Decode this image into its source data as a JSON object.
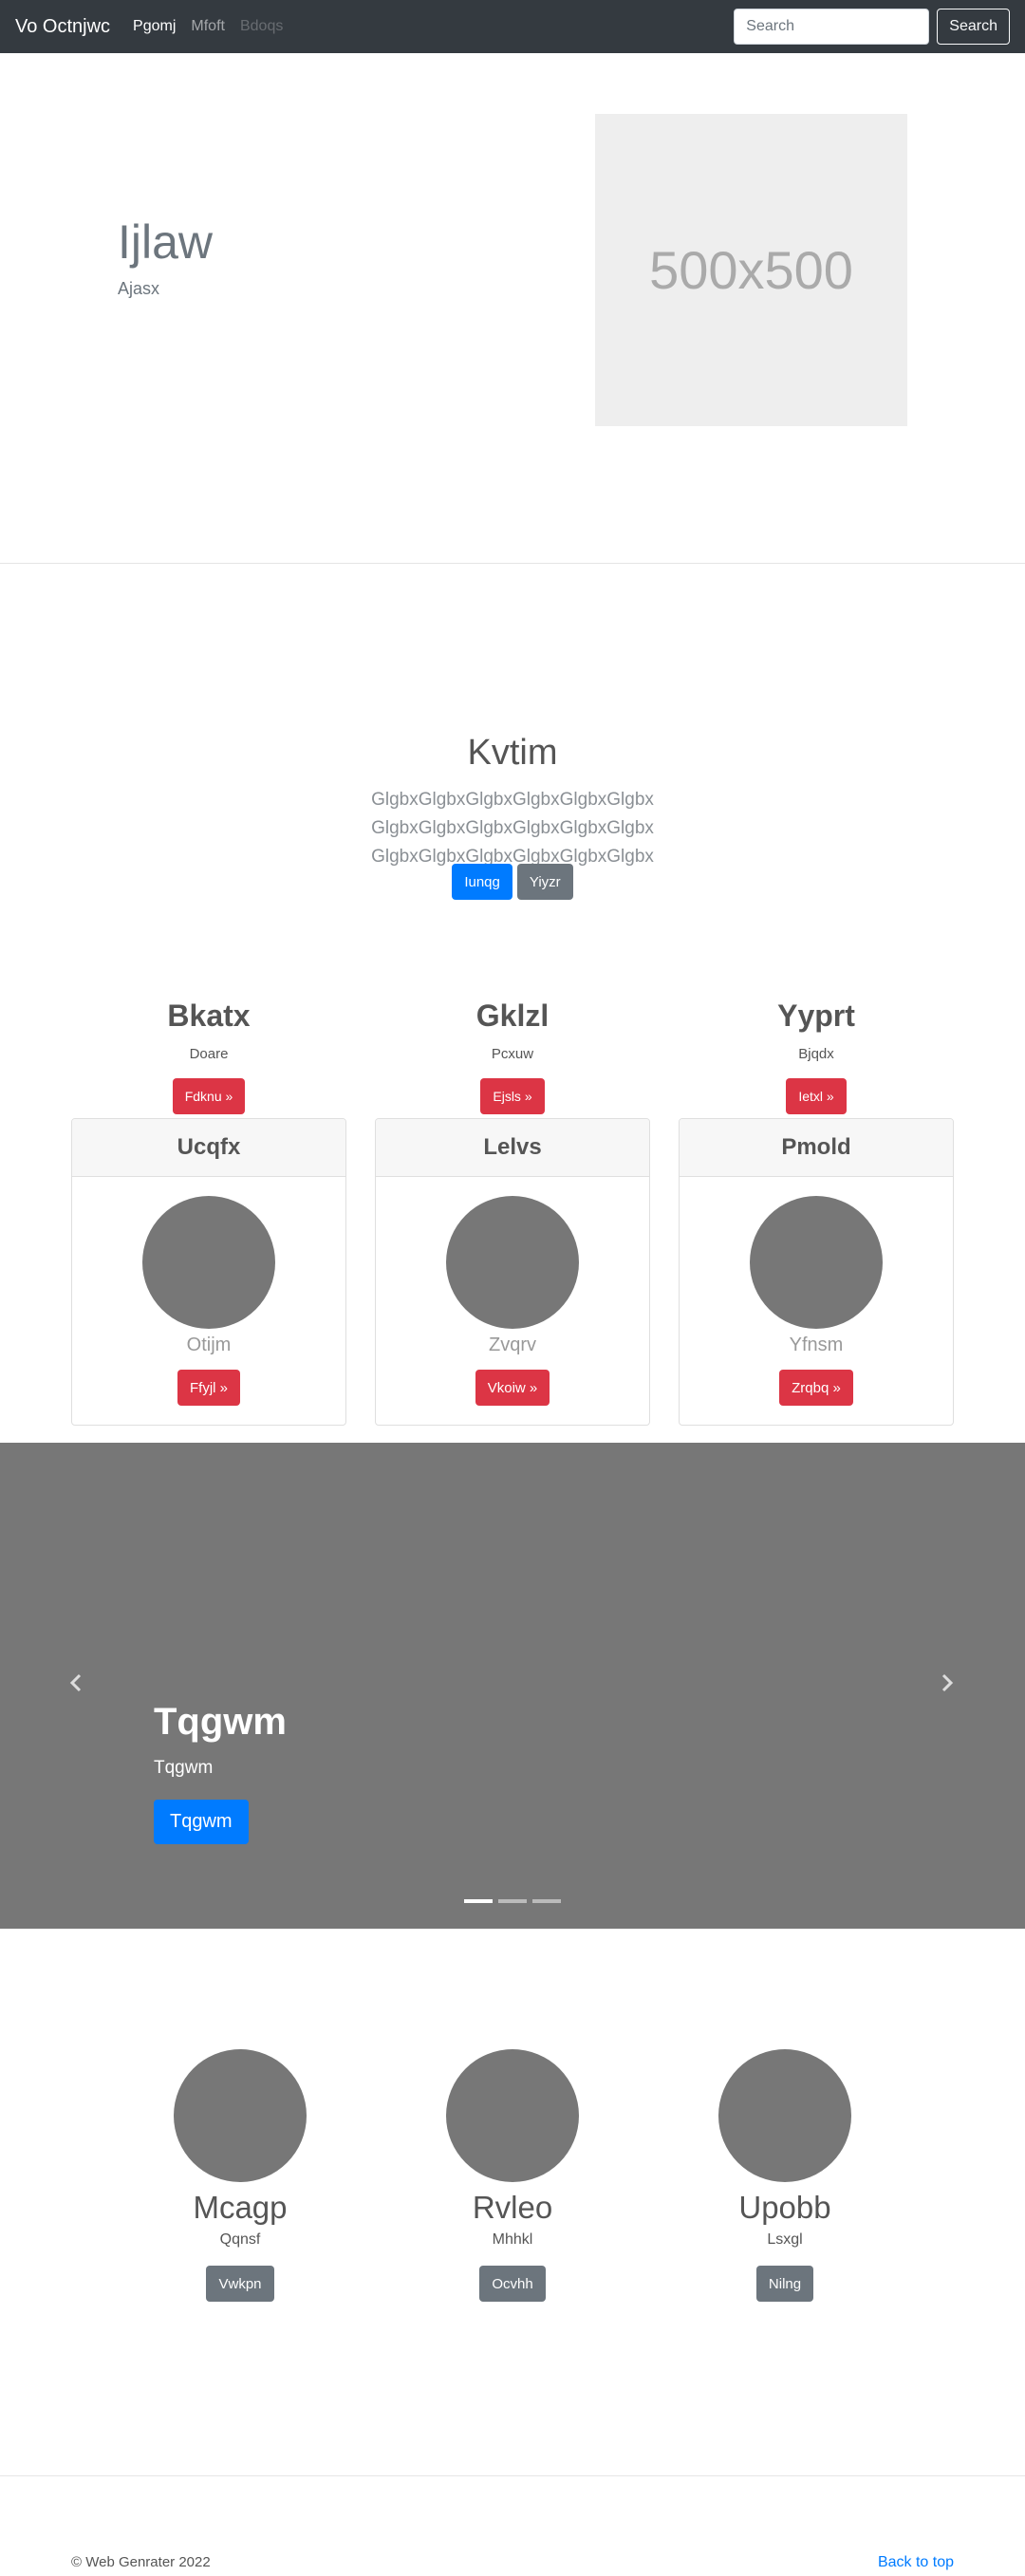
{
  "navbar": {
    "brand": "Vo Octnjwc",
    "links": [
      {
        "label": "Pgomj",
        "state": "active"
      },
      {
        "label": "Mfoft",
        "state": "normal"
      },
      {
        "label": "Bdoqs",
        "state": "disabled"
      }
    ],
    "search_placeholder": "Search",
    "search_button": "Search"
  },
  "hero": {
    "title": "Ijlaw",
    "subtitle": "Ajasx",
    "image_label": "500x500"
  },
  "jumbotron": {
    "title": "Kvtim",
    "text": "GlgbxGlgbxGlgbxGlgbxGlgbxGlgbx GlgbxGlgbxGlgbxGlgbxGlgbxGlgbx GlgbxGlgbxGlgbxGlgbxGlgbxGlgbx",
    "primary_button": "Iunqg",
    "secondary_button": "Yiyzr"
  },
  "features": [
    {
      "title": "Bkatx",
      "subtitle": "Doare",
      "button": "Fdknu »"
    },
    {
      "title": "Gklzl",
      "subtitle": "Pcxuw",
      "button": "Ejsls »"
    },
    {
      "title": "Yyprt",
      "subtitle": "Bjqdx",
      "button": "Ietxl »"
    }
  ],
  "cards": [
    {
      "header": "Ucqfx",
      "name": "Otijm",
      "button": "Ffyjl »"
    },
    {
      "header": "Lelvs",
      "name": "Zvqrv",
      "button": "Vkoiw »"
    },
    {
      "header": "Pmold",
      "name": "Yfnsm",
      "button": "Zrqbq »"
    }
  ],
  "carousel": {
    "title": "Tqgwm",
    "subtitle": "Tqgwm",
    "button": "Tqgwm",
    "prev_icon": "chevron-left-icon",
    "next_icon": "chevron-right-icon",
    "active_slide": 1,
    "slide_count": 3
  },
  "marketing": [
    {
      "name": "Mcagp",
      "subtitle": "Qqnsf",
      "button": "Vwkpn"
    },
    {
      "name": "Rvleo",
      "subtitle": "Mhhkl",
      "button": "Ocvhh"
    },
    {
      "name": "Upobb",
      "subtitle": "Lsxgl",
      "button": "Nilng"
    }
  ],
  "footer": {
    "copyright": "© Web Genrater 2022",
    "back_to_top": "Back to top"
  },
  "colors": {
    "navbar_bg": "#343a40",
    "primary": "#007bff",
    "secondary": "#6c757d",
    "danger": "#dc3545",
    "placeholder_gray": "#777777"
  }
}
